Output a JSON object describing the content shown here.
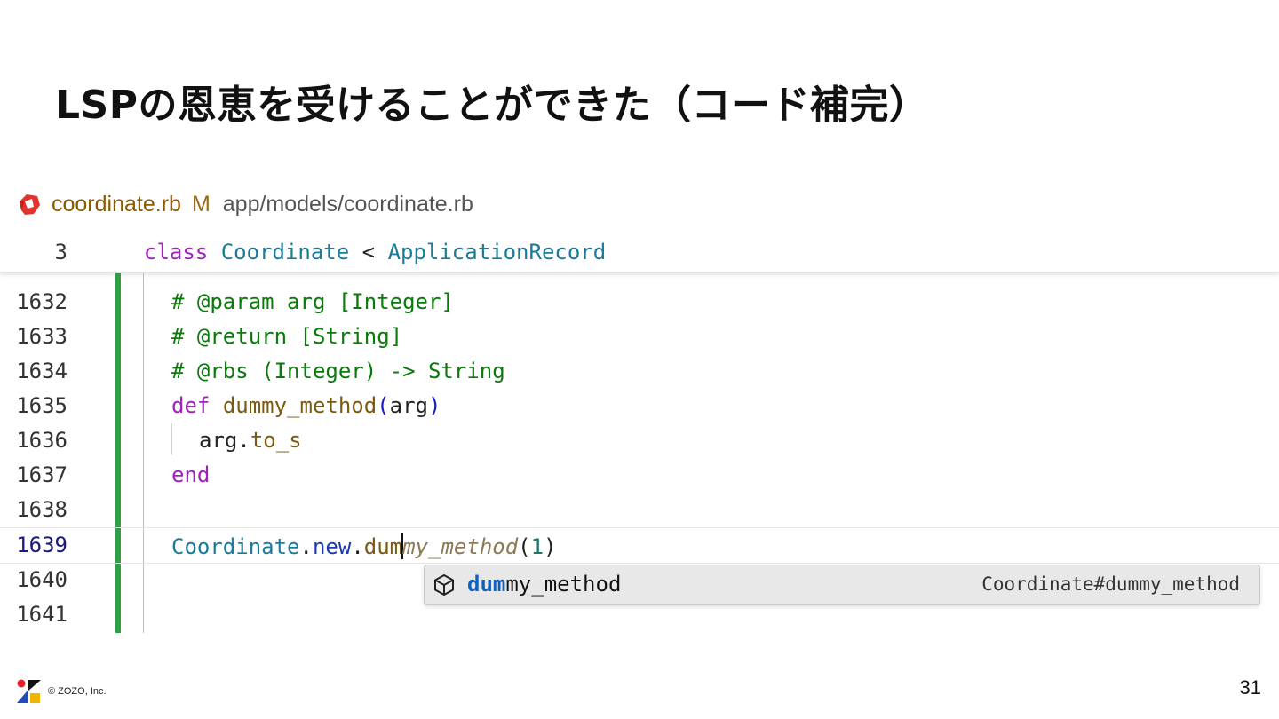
{
  "slide": {
    "title": "LSPの恩恵を受けることができた（コード補完）",
    "page_number": "31",
    "copyright": "© ZOZO, Inc."
  },
  "tab": {
    "file_name": "coordinate.rb",
    "status": "M",
    "path": "app/models/coordinate.rb",
    "icon": "ruby-icon"
  },
  "sticky_scroll": {
    "line_number": "3",
    "keyword": "class",
    "class_name": "Coordinate",
    "op": " < ",
    "parent": "ApplicationRecord"
  },
  "lines": [
    {
      "n": "1632",
      "text": "# @param arg [Integer]"
    },
    {
      "n": "1633",
      "text": "# @return [String]"
    },
    {
      "n": "1634",
      "text": "# @rbs (Integer) -> String"
    },
    {
      "n": "1635",
      "kw": "def",
      "fn": "dummy_method",
      "open": "(",
      "arg": "arg",
      "close": ")"
    },
    {
      "n": "1636",
      "recv": "arg",
      "dot": ".",
      "meth": "to_s"
    },
    {
      "n": "1637",
      "kw": "end"
    },
    {
      "n": "1638"
    },
    {
      "n": "1639",
      "cls": "Coordinate",
      "d1": ".",
      "new": "new",
      "d2": ".",
      "typed": "dum",
      "ghost": "my_method",
      "po": "(",
      "num": "1",
      "pc": ")"
    },
    {
      "n": "1640"
    },
    {
      "n": "1641"
    }
  ],
  "suggestion": {
    "match": "dum",
    "rest": "my_method",
    "detail": "Coordinate#dummy_method",
    "icon": "method-cube-icon"
  },
  "colors": {
    "git_added_bar": "#2ea043",
    "comment": "#0a7a0a",
    "keyword": "#a020c0",
    "class": "#1a7a9a"
  }
}
